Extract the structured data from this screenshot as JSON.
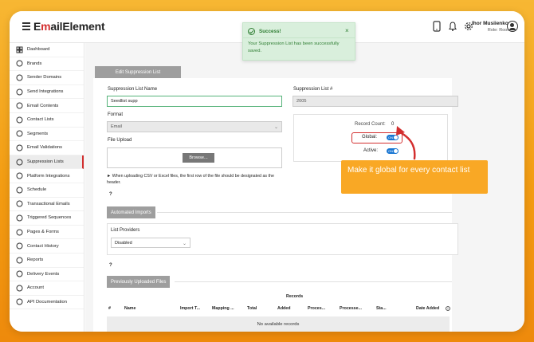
{
  "app": {
    "logo_prefix": "E",
    "logo_accent": "m",
    "logo_suffix": "ailElement"
  },
  "user": {
    "name": "Ihor Musiienko",
    "role": "Role: Root"
  },
  "sidebar": {
    "items": [
      {
        "label": "Dashboard",
        "icon": "dashboard-icon"
      },
      {
        "label": "Brands",
        "icon": "brands-icon"
      },
      {
        "label": "Sender Domains",
        "icon": "globe-icon"
      },
      {
        "label": "Send Integrations",
        "icon": "send-icon"
      },
      {
        "label": "Email Contents",
        "icon": "email-icon"
      },
      {
        "label": "Contact Lists",
        "icon": "contacts-icon"
      },
      {
        "label": "Segments",
        "icon": "segments-icon"
      },
      {
        "label": "Email Validations",
        "icon": "check-circle-icon"
      },
      {
        "label": "Suppression Lists",
        "icon": "block-icon"
      },
      {
        "label": "Platform Integrations",
        "icon": "tag-icon"
      },
      {
        "label": "Schedule",
        "icon": "schedule-icon"
      },
      {
        "label": "Transactional Emails",
        "icon": "transactional-icon"
      },
      {
        "label": "Triggered Sequences",
        "icon": "bolt-icon"
      },
      {
        "label": "Pages & Forms",
        "icon": "pages-icon"
      },
      {
        "label": "Contact History",
        "icon": "history-icon"
      },
      {
        "label": "Reports",
        "icon": "reports-icon"
      },
      {
        "label": "Delivery Events",
        "icon": "delivery-icon"
      },
      {
        "label": "Account",
        "icon": "account-icon"
      },
      {
        "label": "API Documentation",
        "icon": "api-icon"
      }
    ],
    "active_index": 8
  },
  "main": {
    "tab_label": "Edit Suppression List",
    "name_label": "Suppression List Name",
    "name_value": "Seedlist supp",
    "id_label": "Suppression List #",
    "id_value": "2005",
    "format_label": "Format",
    "format_value": "Email",
    "file_upload_label": "File Upload",
    "browse_label": "Browse...",
    "upload_note": "When uploading CSV or Excel files, the first row of the file should be designated as the header.",
    "help_mark": "?",
    "record_count_label": "Record Count:",
    "record_count_value": "0",
    "global_label": "Global:",
    "active_label": "Active:",
    "toggle_on": "ON",
    "global_on": true,
    "active_on": true,
    "automated_imports_label": "Automated Imports",
    "list_providers_label": "List Providers",
    "list_providers_value": "Disabled",
    "previously_uploaded_label": "Previously Uploaded Files",
    "records_group_label": "Records",
    "table_columns": [
      "#",
      "Name",
      "Import T...",
      "Mapping ...",
      "Total",
      "Added",
      "Proces...",
      "Processe...",
      "Sta...",
      "Date Added"
    ],
    "no_records": "No available records"
  },
  "toast": {
    "title": "Success!",
    "message": "Your Suppression List has been successfully saved.",
    "close": "×"
  },
  "callout": {
    "text": "Make it global for every contact list"
  },
  "colors": {
    "accent": "#d32f2f",
    "toggle": "#1976d2",
    "callout": "#f9a825",
    "success": "#2e7d32"
  }
}
